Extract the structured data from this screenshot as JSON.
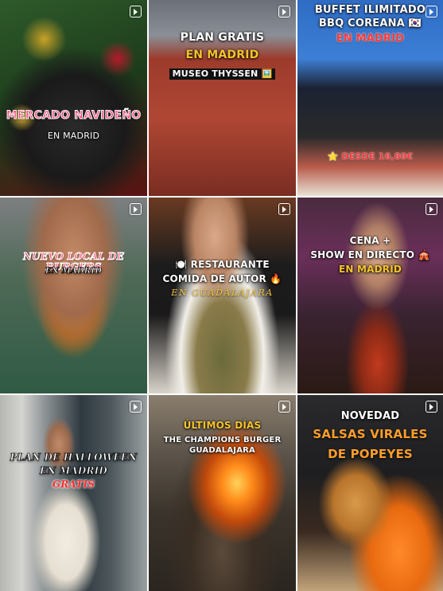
{
  "grid": {
    "tiles": [
      {
        "lines": [
          "MERCADO NAVIDEÑO",
          "EN MADRID"
        ]
      },
      {
        "lines": [
          "PLAN GRATIS",
          "EN MADRID",
          "MUSEO THYSSEN 🖼️"
        ]
      },
      {
        "lines": [
          "BUFFET ILIMITADO",
          "BBQ COREANA 🇰🇷",
          "EN MADRID",
          "⭐ DESDE 16,80€"
        ]
      },
      {
        "lines": [
          "NUEVO LOCAL DE BURGERS",
          "EN MADRID"
        ]
      },
      {
        "lines": [
          "🍽️ RESTAURANTE",
          "COMIDA DE AUTOR 🔥",
          "EN GUADALAJARA"
        ]
      },
      {
        "lines": [
          "CENA +",
          "SHOW EN DIRECTO 🎪",
          "EN MADRID"
        ]
      },
      {
        "lines": [
          "PLAN DE HALLOWEEN",
          "EN MADRID",
          "GRATIS"
        ]
      },
      {
        "lines": [
          "ÚLTIMOS DÍAS",
          "THE CHAMPIONS BURGER",
          "GUADALAJARA"
        ]
      },
      {
        "lines": [
          "NOVEDAD",
          "SALSAS VIRALES",
          "DE POPEYES"
        ]
      }
    ]
  },
  "icons": {
    "reel": "reel-icon"
  },
  "colors": {
    "yellow": "#f7c52b",
    "red": "#ff3b3b",
    "pink": "#ff4a7a"
  }
}
